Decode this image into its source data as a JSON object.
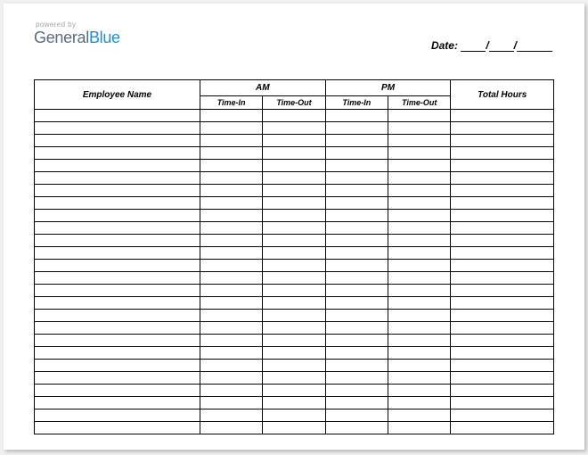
{
  "logo": {
    "powered_by": "powered by",
    "brand_part1": "General",
    "brand_part2": "Blue"
  },
  "date": {
    "label": "Date:"
  },
  "headers": {
    "employee_name": "Employee Name",
    "am": "AM",
    "pm": "PM",
    "total_hours": "Total Hours",
    "time_in": "Time-In",
    "time_out": "Time-Out"
  },
  "row_count": 26
}
